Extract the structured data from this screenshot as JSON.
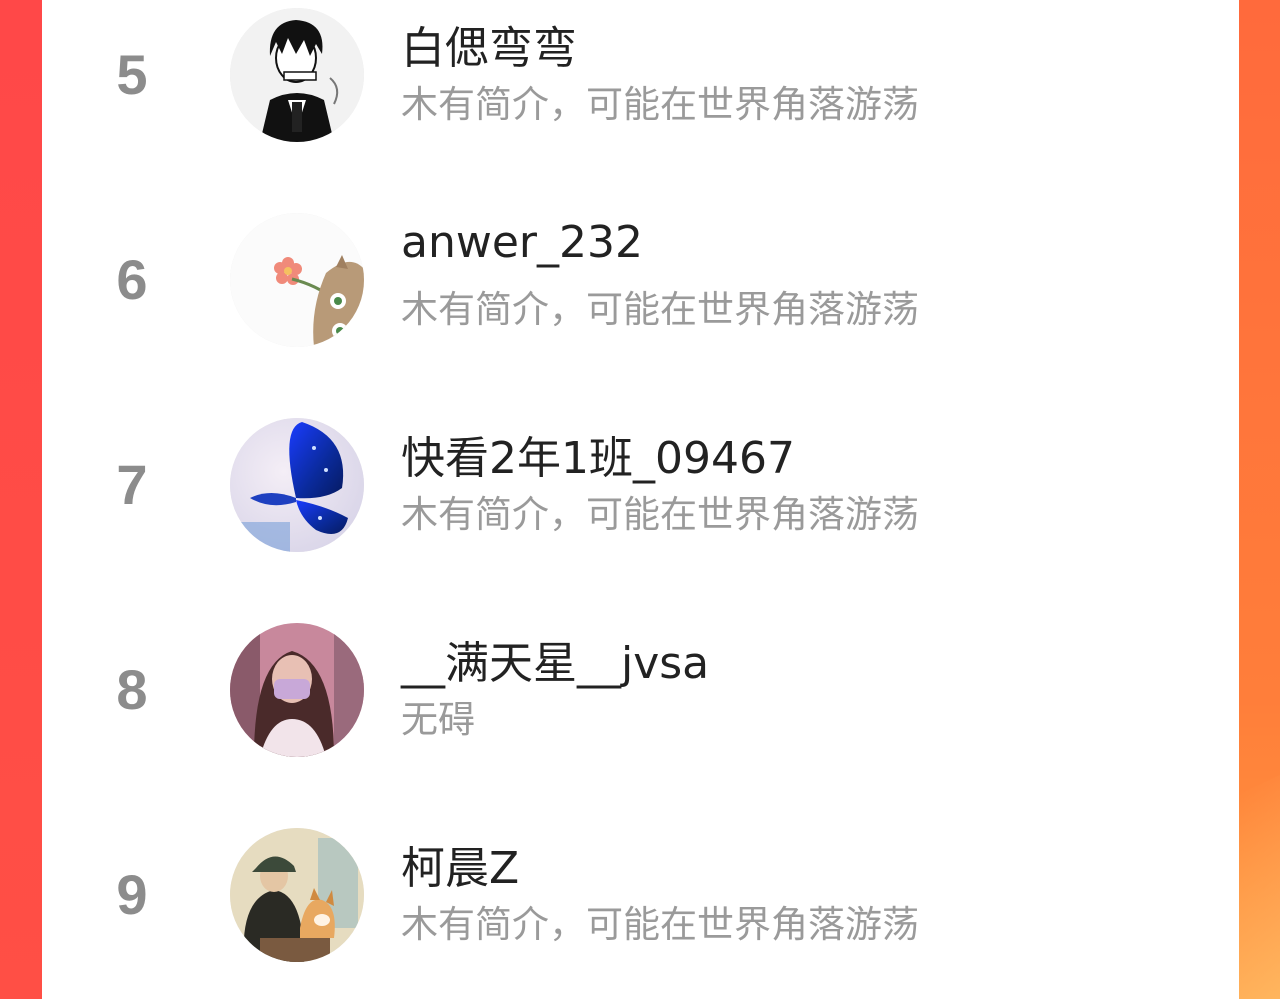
{
  "colors": {
    "background_accent": "#ff5040",
    "panel": "#ffffff",
    "rank_text": "#8c8c8c",
    "name_text": "#222222",
    "bio_text": "#9a9a9a"
  },
  "ranking": {
    "rows": [
      {
        "rank": "5",
        "name": "白偲弯弯",
        "bio": "木有简介，可能在世界角落游荡",
        "avatar_icon": "anime-boy-avatar-icon"
      },
      {
        "rank": "6",
        "name": "anwer_232",
        "bio": "木有简介，可能在世界角落游荡",
        "avatar_icon": "cat-flower-avatar-icon"
      },
      {
        "rank": "7",
        "name": "快看2年1班_09467",
        "bio": "木有简介，可能在世界角落游荡",
        "avatar_icon": "blue-butterfly-avatar-icon"
      },
      {
        "rank": "8",
        "name": "__满天星__jvsa",
        "bio": "无碍",
        "avatar_icon": "masked-girl-avatar-icon"
      },
      {
        "rank": "9",
        "name": "柯晨Z",
        "bio": "木有简介，可能在世界角落游荡",
        "avatar_icon": "illustration-dog-avatar-icon"
      }
    ]
  }
}
